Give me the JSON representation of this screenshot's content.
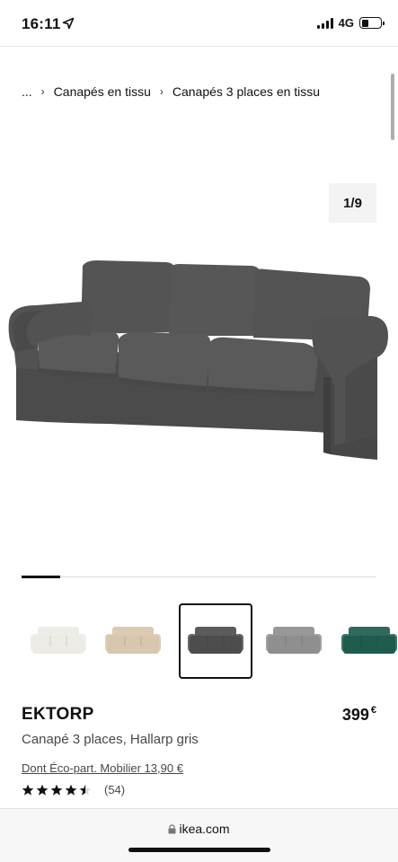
{
  "status_bar": {
    "time": "16:11",
    "network": "4G",
    "battery_level": 0.35,
    "icons": [
      "location-arrow-icon",
      "signal-icon",
      "battery-icon"
    ]
  },
  "breadcrumb": {
    "items": [
      "...",
      "Canapés en tissu",
      "Canapés 3 places en tissu"
    ]
  },
  "gallery": {
    "counter": "1/9",
    "progress_fraction": 0.11,
    "thumbnails": [
      {
        "color_name": "white",
        "color": "#ecebe6"
      },
      {
        "color_name": "beige",
        "color": "#d8c7ad"
      },
      {
        "color_name": "gray",
        "color": "#4d4d4d",
        "selected": true
      },
      {
        "color_name": "light-gray",
        "color": "#8f8f8f"
      },
      {
        "color_name": "green",
        "color": "#1f5c4e"
      }
    ]
  },
  "product": {
    "name": "EKTORP",
    "description": "Canapé 3 places, Hallarp gris",
    "price": "399",
    "currency": "€",
    "eco_part": "Dont Éco-part. Mobilier 13,90 €",
    "rating": 4.5,
    "rating_count": "(54)"
  },
  "browser": {
    "url": "ikea.com"
  },
  "colors": {
    "sofa_main": "#4f4f4f",
    "sofa_shadow": "#3e3e3e",
    "sofa_light": "#5c5c5c",
    "text_secondary": "#484848"
  }
}
